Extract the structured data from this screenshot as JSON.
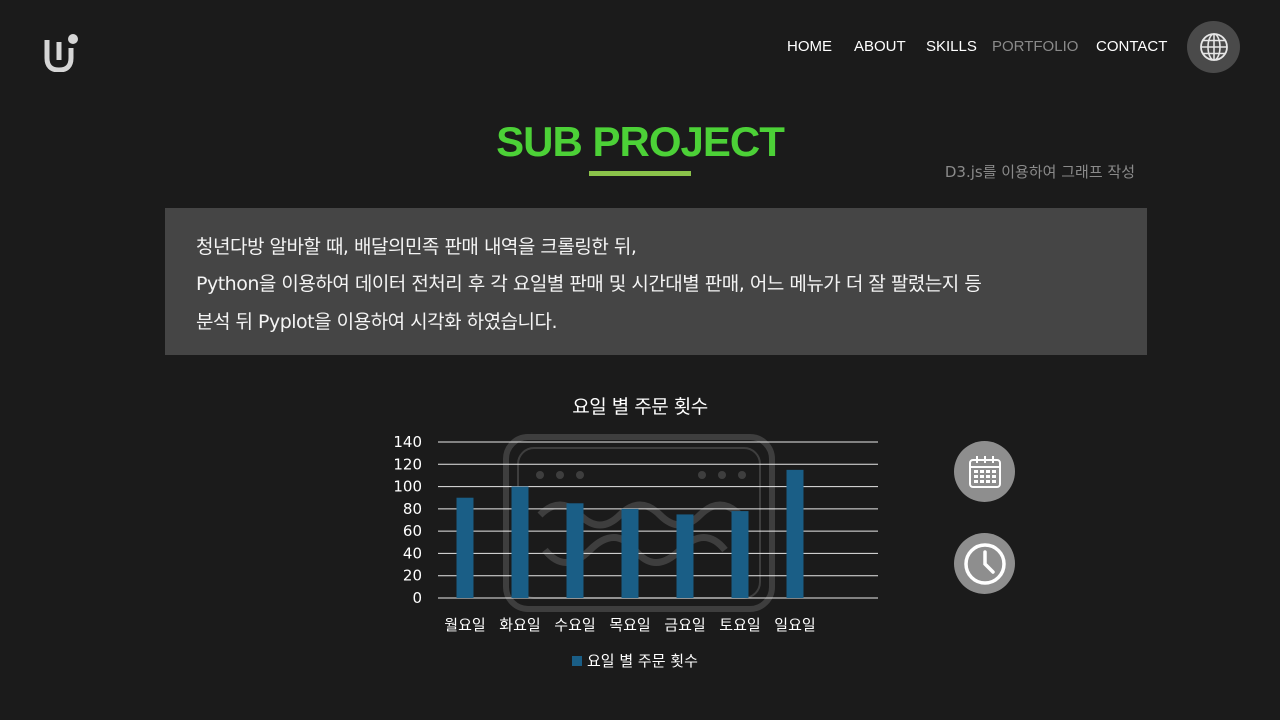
{
  "header": {
    "logo_icon": "u-hook-logo",
    "nav": [
      {
        "label": "HOME",
        "active": false
      },
      {
        "label": "ABOUT",
        "active": false
      },
      {
        "label": "SKILLS",
        "active": false
      },
      {
        "label": "PORTFOLIO",
        "active": true
      },
      {
        "label": "CONTACT",
        "active": false
      }
    ],
    "language_icon": "globe-icon"
  },
  "section": {
    "title": "SUB PROJECT",
    "caption": "D3.js를 이용하여 그래프 작성",
    "description": [
      "청년다방 알바할 때, 배달의민족 판매 내역을 크롤링한 뒤,",
      "Python을 이용하여 데이터 전처리 후 각 요일별 판매 및 시간대별 판매, 어느 메뉴가 더 잘 팔렸는지 등",
      "분석 뒤 Pyplot을 이용하여 시각화 하였습니다."
    ]
  },
  "colors": {
    "accent": "#4cd137",
    "underline": "#8bc34a",
    "bar": "#1a5e86",
    "panel": "#454545",
    "background": "#1b1b1b"
  },
  "chart_data": {
    "type": "bar",
    "title": "요일 별 주문 횟수",
    "categories": [
      "월요일",
      "화요일",
      "수요일",
      "목요일",
      "금요일",
      "토요일",
      "일요일"
    ],
    "series": [
      {
        "name": "요일 별 주문 횟수",
        "values": [
          90,
          100,
          85,
          80,
          75,
          78,
          115
        ]
      }
    ],
    "ylim": [
      0,
      140
    ],
    "yticks": [
      0,
      20,
      40,
      60,
      80,
      100,
      120,
      140
    ],
    "grid": true,
    "legend": "bottom",
    "watermark": "cafe-stamp-logo"
  },
  "side_buttons": [
    {
      "icon": "calendar-icon"
    },
    {
      "icon": "clock-icon"
    }
  ]
}
